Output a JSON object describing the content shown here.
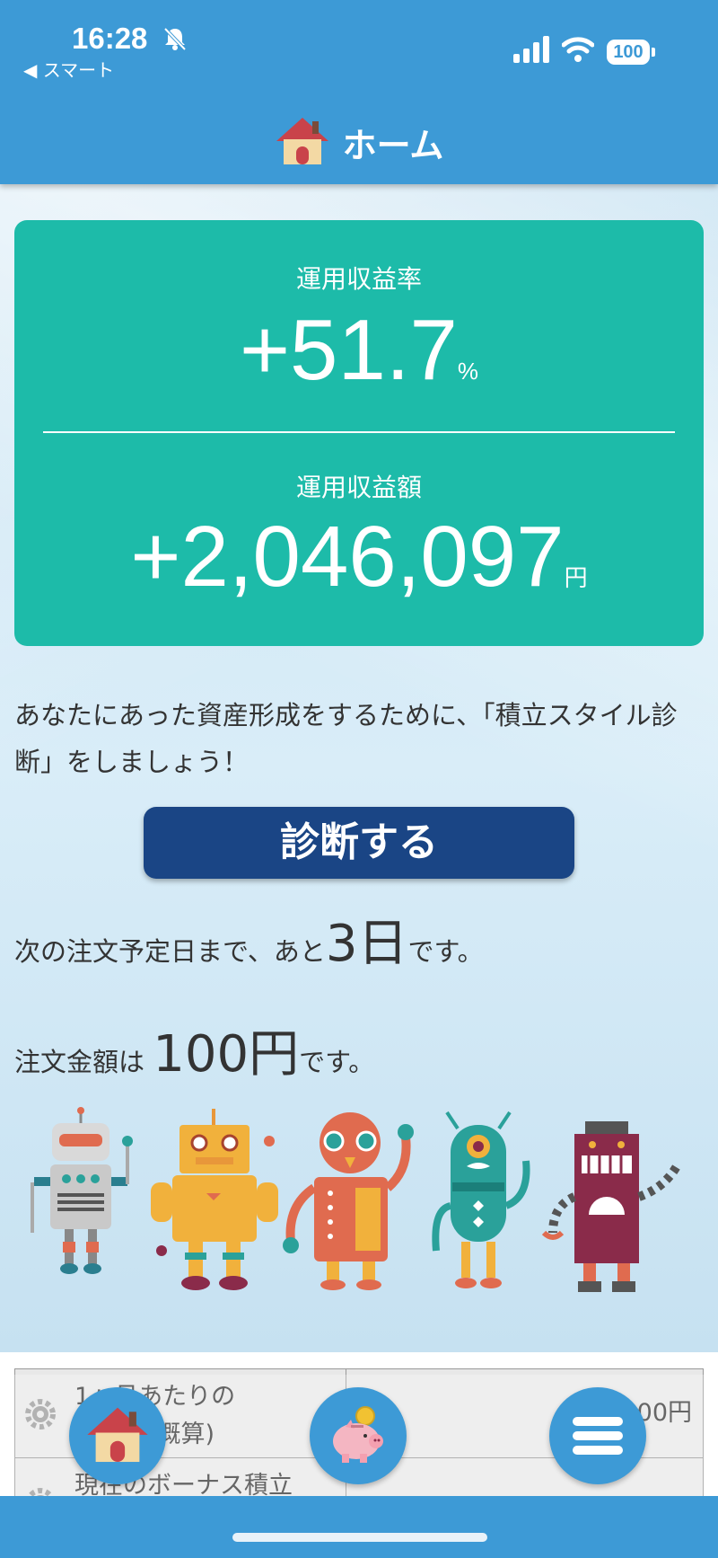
{
  "status_bar": {
    "time": "16:28",
    "back_app": "◀ スマート",
    "battery": "100"
  },
  "header": {
    "title": "ホーム"
  },
  "card": {
    "rate_label": "運用収益率",
    "rate_value": "+51.7",
    "rate_unit": "%",
    "amount_label": "運用収益額",
    "amount_value": "+2,046,097",
    "amount_unit": "円"
  },
  "prompt": {
    "text": "あなたにあった資産形成をするために、「積立スタイル診断」をしましょう！"
  },
  "diagnose_button": {
    "label": "診断する"
  },
  "next_order": {
    "prefix": "次の注文予定日まで、あと",
    "value": "3日",
    "suffix": "です。"
  },
  "order_amount": {
    "prefix": "注文金額は",
    "value": "100円",
    "suffix": "です。"
  },
  "table": {
    "rows": [
      {
        "label": "1ヶ月あたりの\n積立額(概算)",
        "value": "00円"
      },
      {
        "label": "現在のボーナス積立",
        "value": ""
      }
    ]
  },
  "icons": {
    "header": "house-icon",
    "tabs": [
      "house-icon",
      "piggy-bank-icon",
      "menu-icon"
    ]
  },
  "colors": {
    "header": "#3d9ad6",
    "card": "#1dbba9",
    "button": "#1a4585"
  }
}
